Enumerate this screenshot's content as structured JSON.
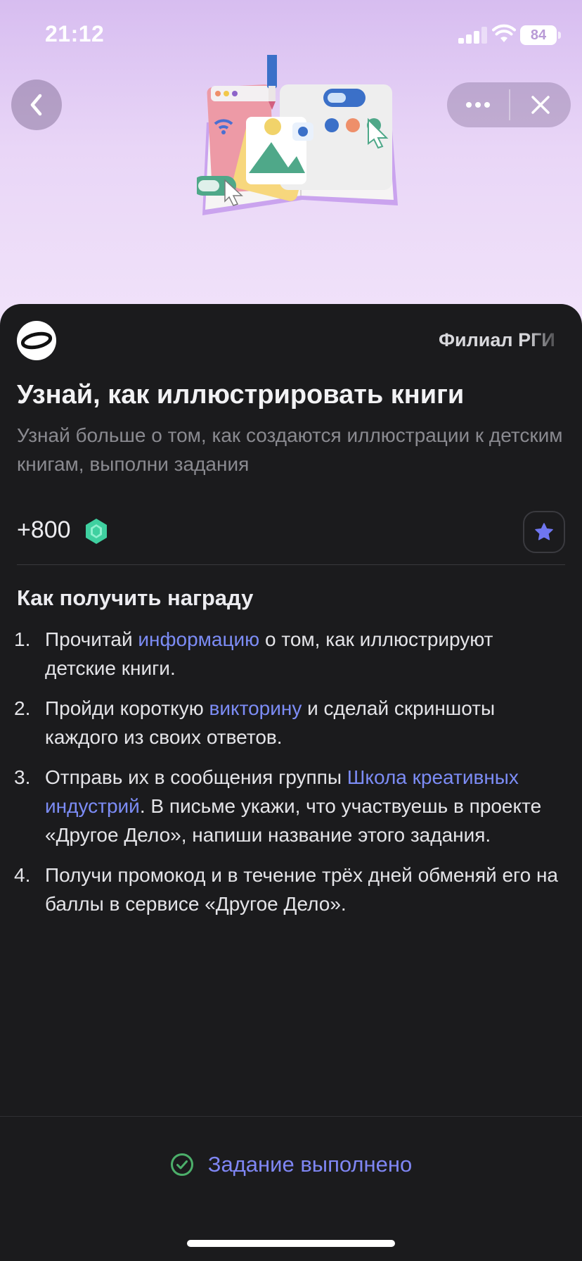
{
  "status_bar": {
    "time": "21:12",
    "battery": "84"
  },
  "nav": {
    "back_icon": "chevron-left-icon",
    "more_icon": "more-horizontal-icon",
    "close_icon": "close-icon"
  },
  "task": {
    "org_name": "Филиал РГИ",
    "title": "Узнай, как иллюстрировать книги",
    "subtitle": "Узнай больше о том, как создаются иллюстрации к детским книгам, выполни задания",
    "reward": "+800",
    "reward_icon": "gem-icon",
    "favorite_icon": "star-icon"
  },
  "how_to": {
    "title": "Как получить награду",
    "steps": [
      {
        "num": "1.",
        "a": "Прочитай ",
        "link": "информацию",
        "b": " о том, как иллюстрируют детские книги."
      },
      {
        "num": "2.",
        "a": "Пройди короткую ",
        "link": "викторину",
        "b": " и сделай скриншоты каждого из своих ответов."
      },
      {
        "num": "3.",
        "a": "Отправь их в сообщения группы ",
        "link": "Школа креативных индустрий",
        "b": ". В письме укажи, что участвуешь в проекте «Другое Дело», напиши название этого задания."
      },
      {
        "num": "4.",
        "a": "Получи промокод и в течение трёх дней обменяй его на баллы в сервисе «Другое Дело».",
        "link": "",
        "b": ""
      }
    ]
  },
  "footer": {
    "status": "Задание выполнено",
    "status_icon": "check-circle-icon"
  },
  "colors": {
    "accent": "#7c8cf5",
    "done": "#7f86f3",
    "done_check": "#4caf6a",
    "gem": "#3fd0a0",
    "background": "#1b1b1d"
  }
}
